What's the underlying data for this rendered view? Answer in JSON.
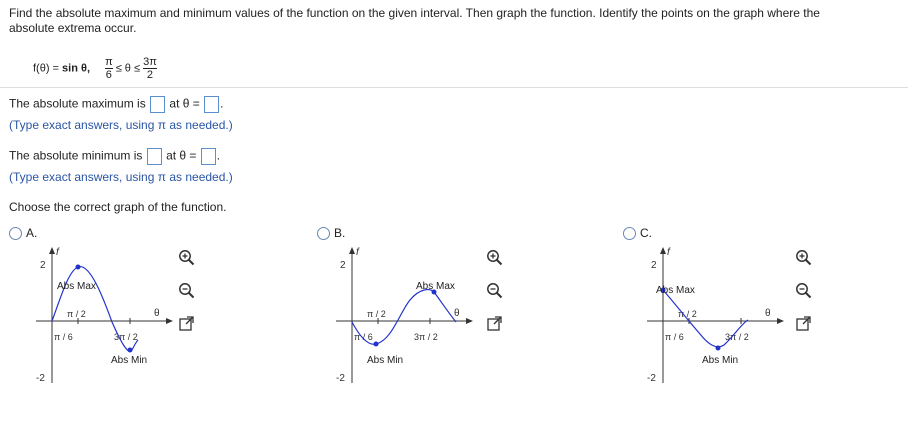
{
  "question": {
    "line1": "Find the absolute maximum and minimum values of the function on the given interval. Then graph the function. Identify the points on the graph where the",
    "line2": "absolute extrema occur.",
    "func_prefix": "f(θ) = ",
    "func_name": "sin θ,",
    "low_num": "π",
    "low_den": "6",
    "ineq": "≤ θ ≤",
    "high_num": "3π",
    "high_den": "2"
  },
  "max_part": {
    "label": "The absolute maximum is",
    "at_label": "at θ =",
    "period": ".",
    "hint": "(Type exact answers, using π as needed.)"
  },
  "min_part": {
    "label": "The absolute minimum is",
    "at_label": "at θ =",
    "period": ".",
    "hint": "(Type exact answers, using π as needed.)"
  },
  "choose_label": "Choose the correct graph of the function.",
  "options": [
    {
      "label": "A.",
      "axis": {
        "y_top": "2",
        "y_bottom": "-2",
        "y_axis_label": "f",
        "x_axis_label": "θ"
      },
      "ticks": {
        "left": "π / 6",
        "mid_top": "π / 2",
        "right_bottom": "3π / 2"
      },
      "max_label": "Abs Max",
      "min_label": "Abs Min",
      "curve_color": "#2233cc",
      "extremum_points": [
        {
          "role": "max",
          "x": "π / 2",
          "y": 1
        },
        {
          "role": "min",
          "x": "3π / 2",
          "y": -1
        }
      ]
    },
    {
      "label": "B.",
      "axis": {
        "y_top": "2",
        "y_bottom": "-2",
        "y_axis_label": "f",
        "x_axis_label": "θ"
      },
      "ticks": {
        "left": "π / 6",
        "mid_top": "π / 2",
        "right_bottom": "3π / 2"
      },
      "max_label": "Abs Max",
      "min_label": "Abs Min",
      "curve_color": "#2233cc",
      "extremum_points": [
        {
          "role": "min",
          "x": "π / 6",
          "y": -0.5
        },
        {
          "role": "max",
          "x": "3π / 2",
          "y": 1
        }
      ]
    },
    {
      "label": "C.",
      "axis": {
        "y_top": "2",
        "y_bottom": "-2",
        "y_axis_label": "f",
        "x_axis_label": "θ"
      },
      "ticks": {
        "left": "π / 6",
        "mid_top": "π / 2",
        "right_bottom": "3π / 2"
      },
      "max_label": "Abs Max",
      "min_label": "Abs Min",
      "curve_color": "#2233cc",
      "extremum_points": [
        {
          "role": "max",
          "x": "π / 6",
          "y": 0.5
        },
        {
          "role": "min",
          "x": "π",
          "y": -1
        }
      ]
    }
  ]
}
